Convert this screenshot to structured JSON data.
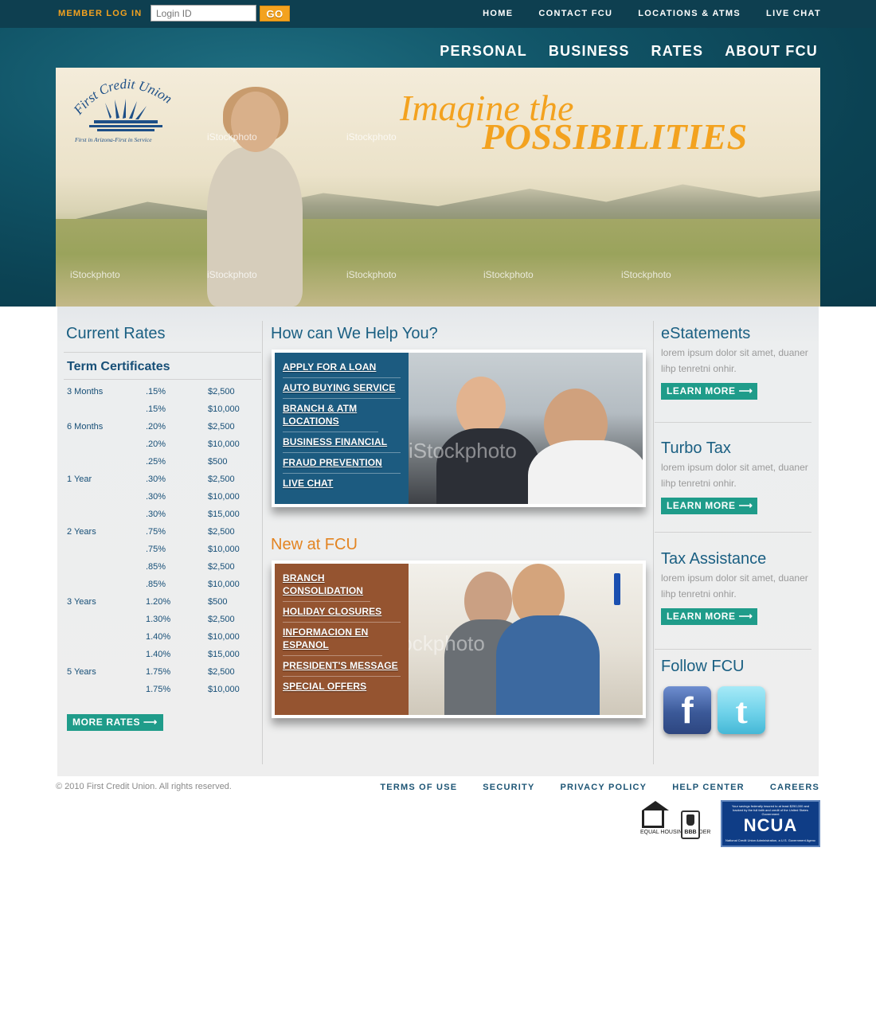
{
  "topbar": {
    "login_label": "MEMBER LOG IN",
    "login_placeholder": "Login ID",
    "go_label": "GO",
    "links": [
      "HOME",
      "CONTACT FCU",
      "LOCATIONS & ATMS",
      "LIVE CHAT"
    ]
  },
  "main_nav": [
    "PERSONAL",
    "BUSINESS",
    "RATES",
    "ABOUT FCU"
  ],
  "hero": {
    "logo_name": "First Credit Union",
    "logo_tagline": "First in Arizona-First in Service",
    "headline_line1": "Imagine the",
    "headline_line2": "POSSIBILITIES",
    "watermark_text": "iStockphoto"
  },
  "rates": {
    "title": "Current Rates",
    "subtitle": "Term Certificates",
    "rows": [
      {
        "term": "3 Months",
        "rate": ".15%",
        "amount": "$2,500"
      },
      {
        "term": "",
        "rate": ".15%",
        "amount": "$10,000"
      },
      {
        "term": "6 Months",
        "rate": ".20%",
        "amount": "$2,500"
      },
      {
        "term": "",
        "rate": ".20%",
        "amount": "$10,000"
      },
      {
        "term": "",
        "rate": ".25%",
        "amount": "$500"
      },
      {
        "term": "1 Year",
        "rate": ".30%",
        "amount": "$2,500"
      },
      {
        "term": "",
        "rate": ".30%",
        "amount": "$10,000"
      },
      {
        "term": "",
        "rate": ".30%",
        "amount": "$15,000"
      },
      {
        "term": "2 Years",
        "rate": ".75%",
        "amount": "$2,500"
      },
      {
        "term": "",
        "rate": ".75%",
        "amount": "$10,000"
      },
      {
        "term": "",
        "rate": ".85%",
        "amount": "$2,500"
      },
      {
        "term": "",
        "rate": ".85%",
        "amount": "$10,000"
      },
      {
        "term": "3 Years",
        "rate": "1.20%",
        "amount": "$500"
      },
      {
        "term": "",
        "rate": "1.30%",
        "amount": "$2,500"
      },
      {
        "term": "",
        "rate": "1.40%",
        "amount": "$10,000"
      },
      {
        "term": "",
        "rate": "1.40%",
        "amount": "$15,000"
      },
      {
        "term": "5 Years",
        "rate": "1.75%",
        "amount": "$2,500"
      },
      {
        "term": "",
        "rate": "1.75%",
        "amount": "$10,000"
      }
    ],
    "more_button": "MORE RATES ⟶"
  },
  "help": {
    "title": "How can We Help You?",
    "items": [
      "APPLY FOR A LOAN",
      "AUTO BUYING SERVICE",
      "BRANCH & ATM LOCATIONS",
      "BUSINESS FINANCIAL",
      "FRAUD PREVENTION",
      "LIVE CHAT"
    ]
  },
  "new_at": {
    "title": "New at FCU",
    "items": [
      "BRANCH CONSOLIDATION",
      "HOLIDAY CLOSURES",
      "INFORMACION EN ESPANOL",
      "PRESIDENT'S MESSAGE",
      "SPECIAL OFFERS"
    ]
  },
  "side": {
    "sections": [
      {
        "title": "eStatements",
        "text": "lorem ipsum dolor sit amet, duaner lihp tenretni onhir.",
        "button": "LEARN MORE ⟶"
      },
      {
        "title": "Turbo Tax",
        "text": "lorem ipsum dolor sit amet, duaner lihp tenretni onhir.",
        "button": "LEARN MORE ⟶"
      },
      {
        "title": "Tax Assistance",
        "text": "lorem ipsum dolor sit amet, duaner lihp tenretni onhir.",
        "button": "LEARN MORE ⟶"
      }
    ],
    "follow_title": "Follow FCU"
  },
  "footer": {
    "copyright": "© 2010 First Credit Union. All rights reserved.",
    "links": [
      "TERMS OF USE",
      "SECURITY",
      "PRIVACY POLICY",
      "HELP CENTER",
      "CAREERS"
    ],
    "ehl_text": "EQUAL HOUSING LENDER",
    "bbb_text": "BBB",
    "ncua_top": "Your savings federally insured to at least $250,000 and backed by the full faith and credit of the United States Government",
    "ncua_main": "NCUA",
    "ncua_bottom": "National Credit Union Administration, a U.S. Government Agency"
  },
  "colors": {
    "brand_dark": "#0e3f50",
    "accent_orange": "#f3a21f",
    "title_blue": "#1a5f82",
    "button_teal": "#1f9c8a",
    "menu_blue": "#1c5b80",
    "menu_brown": "#955430"
  },
  "icons": [
    "facebook-icon",
    "twitter-icon",
    "equal-housing-lender-icon",
    "bbb-icon",
    "arrow-right-icon"
  ]
}
